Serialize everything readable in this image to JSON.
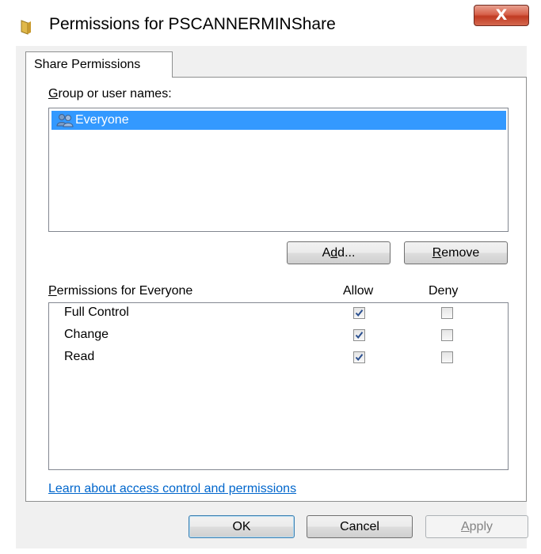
{
  "window": {
    "title": "Permissions for PSCANNERMINShare",
    "close_label": "X"
  },
  "tabs": [
    {
      "label": "Share Permissions"
    }
  ],
  "group_section": {
    "label": "Group or user names:",
    "users": [
      {
        "name": "Everyone",
        "icon": "users-icon",
        "selected": true
      }
    ]
  },
  "buttons": {
    "add": "Add...",
    "remove": "Remove",
    "ok": "OK",
    "cancel": "Cancel",
    "apply": "Apply"
  },
  "permissions": {
    "label": "Permissions for Everyone",
    "allow_header": "Allow",
    "deny_header": "Deny",
    "rows": [
      {
        "name": "Full Control",
        "allow": true,
        "deny": false
      },
      {
        "name": "Change",
        "allow": true,
        "deny": false
      },
      {
        "name": "Read",
        "allow": true,
        "deny": false
      }
    ]
  },
  "link": "Learn about access control and permissions",
  "colors": {
    "selection": "#3399ff",
    "link": "#0066cc",
    "close_button": "#c9472e"
  }
}
